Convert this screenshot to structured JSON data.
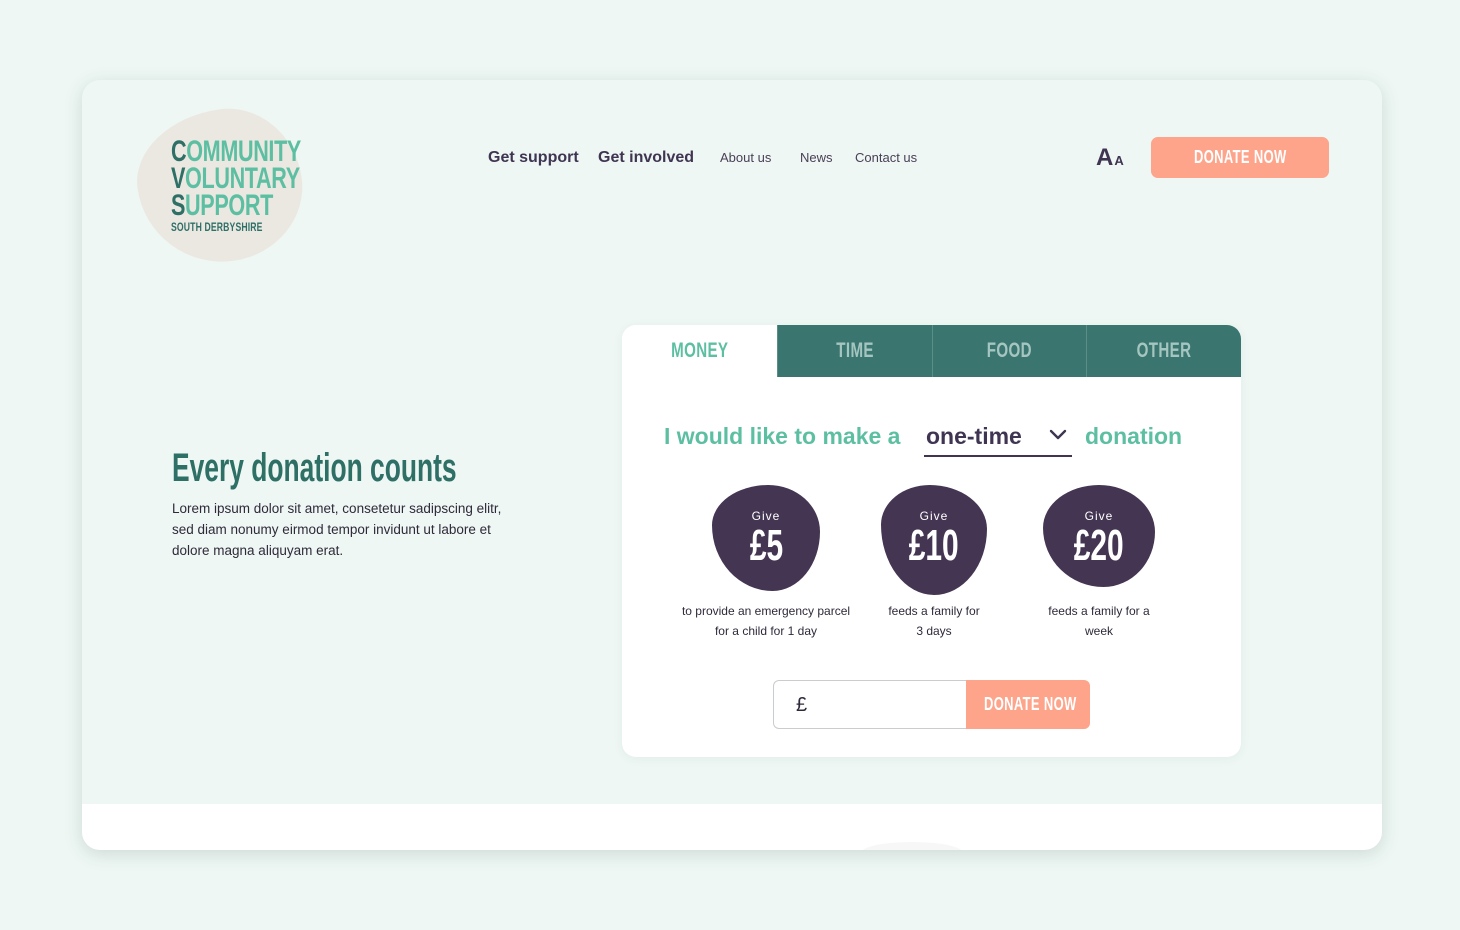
{
  "logo": {
    "lines": [
      {
        "initial": "C",
        "rest": "OMMUNITY"
      },
      {
        "initial": "V",
        "rest": "OLUNTARY"
      },
      {
        "initial": "S",
        "rest": "UPPORT"
      }
    ],
    "subtitle": "SOUTH DERBYSHIRE"
  },
  "nav": {
    "primary": [
      "Get support",
      "Get involved"
    ],
    "secondary": [
      "About us",
      "News",
      "Contact us"
    ]
  },
  "font_toggle": {
    "large": "A",
    "small": "A"
  },
  "header_donate_label": "DONATE NOW",
  "hero": {
    "title": "Every donation counts",
    "body": "Lorem ipsum dolor sit amet, consetetur sadipscing elitr, sed diam nonumy eirmod tempor invidunt ut labore et dolore magna aliquyam erat."
  },
  "donation_card": {
    "tabs": [
      {
        "label": "MONEY",
        "active": true
      },
      {
        "label": "TIME",
        "active": false
      },
      {
        "label": "FOOD",
        "active": false
      },
      {
        "label": "OTHER",
        "active": false
      }
    ],
    "sentence_prefix": "I would like to make a",
    "frequency": "one-time",
    "sentence_suffix": "donation",
    "options": [
      {
        "label": "Give",
        "amount": "£5",
        "description": "to provide an emergency parcel for a child for 1 day"
      },
      {
        "label": "Give",
        "amount": "£10",
        "description": "feeds a family for 3 days"
      },
      {
        "label": "Give",
        "amount": "£20",
        "description": "feeds a family for a week"
      }
    ],
    "currency_symbol": "£",
    "amount_value": "",
    "donate_label": "DONATE NOW"
  },
  "colors": {
    "page_background": "#eef7f3",
    "brand_teal": "#2e6f66",
    "accent_mint": "#5dbfa2",
    "tab_background": "#3a766f",
    "button_coral": "#fda48a",
    "blob_purple": "#443652",
    "text_dark": "#3f3552",
    "logo_blob": "#ebe8e2"
  },
  "icons": [
    "chevron-down-icon"
  ]
}
